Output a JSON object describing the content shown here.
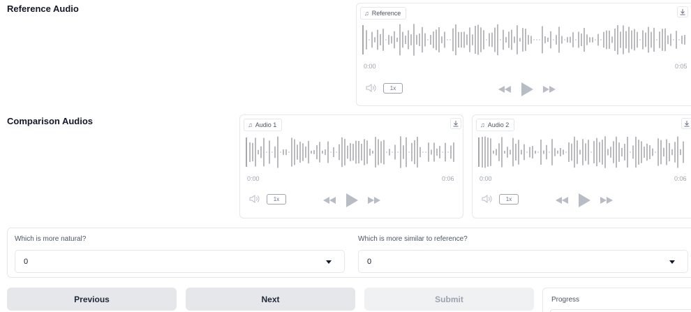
{
  "reference": {
    "heading": "Reference Audio",
    "chip": "Reference",
    "start_time": "0:00",
    "end_time": "0:05",
    "rate": "1x"
  },
  "comparison": {
    "heading": "Comparison Audios",
    "players": [
      {
        "chip": "Audio 1",
        "start_time": "0:00",
        "end_time": "0:06",
        "rate": "1x"
      },
      {
        "chip": "Audio 2",
        "start_time": "0:00",
        "end_time": "0:06",
        "rate": "1x"
      }
    ]
  },
  "questions": {
    "natural_label": "Which is more natural?",
    "natural_value": "0",
    "similar_label": "Which is more similar to reference?",
    "similar_value": "0"
  },
  "buttons": {
    "previous": "Previous",
    "next": "Next",
    "submit": "Submit"
  },
  "progress": {
    "label": "Progress"
  },
  "icons": {
    "music": "music-note-icon",
    "download": "download-icon",
    "volume": "volume-icon",
    "rewind": "rewind-icon",
    "play": "play-icon",
    "forward": "fast-forward-icon"
  },
  "colors": {
    "waveform": "#a8a8ae",
    "controls": "#b8bcc4",
    "button_bg": "#e5e7eb",
    "border": "#e5e7eb"
  }
}
